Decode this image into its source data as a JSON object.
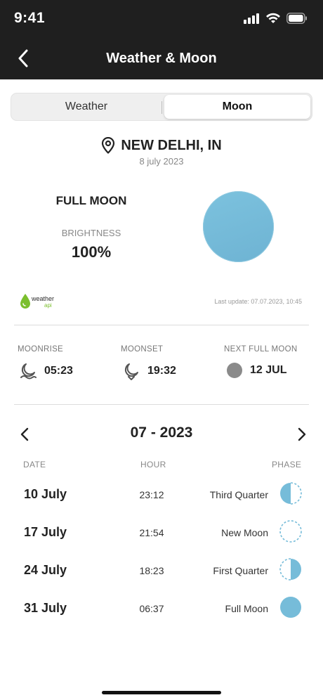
{
  "status_bar": {
    "time": "9:41"
  },
  "header": {
    "title": "Weather & Moon"
  },
  "tabs": [
    {
      "label": "Weather",
      "selected": false
    },
    {
      "label": "Moon",
      "selected": true
    }
  ],
  "location": {
    "name": "NEW DELHI, IN",
    "date": "8 july 2023"
  },
  "current": {
    "phase": "FULL MOON",
    "brightness_label": "BRIGHTNESS",
    "brightness_value": "100%",
    "moon_color": "#76bcd9"
  },
  "source": {
    "logo_text": "weather",
    "logo_sub": "api",
    "last_update": "Last update: 07.07.2023, 10:45"
  },
  "stats": {
    "moonrise": {
      "label": "MOONRISE",
      "value": "05:23",
      "icon": "moonrise-icon"
    },
    "moonset": {
      "label": "MOONSET",
      "value": "19:32",
      "icon": "moonset-icon"
    },
    "next_full": {
      "label": "NEXT FULL MOON",
      "value": "12 JUL",
      "icon": "full-moon-dot-icon"
    }
  },
  "calendar": {
    "title": "07 -  2023",
    "columns": {
      "date": "DATE",
      "hour": "HOUR",
      "phase": "PHASE"
    },
    "rows": [
      {
        "date": "10 July",
        "hour": "23:12",
        "phase": "Third Quarter",
        "icon": "third-quarter-icon"
      },
      {
        "date": "17 July",
        "hour": "21:54",
        "phase": "New Moon",
        "icon": "new-moon-icon"
      },
      {
        "date": "24 July",
        "hour": "18:23",
        "phase": "First Quarter",
        "icon": "first-quarter-icon"
      },
      {
        "date": "31 July",
        "hour": "06:37",
        "phase": "Full Moon",
        "icon": "full-moon-icon"
      }
    ]
  },
  "colors": {
    "header_bg": "#1f1f1f",
    "moon_blue": "#76bcd9",
    "muted": "#888888"
  }
}
